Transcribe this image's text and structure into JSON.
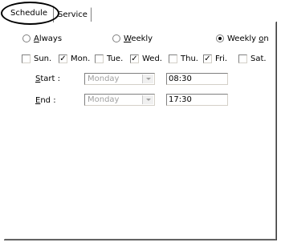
{
  "tabs": [
    {
      "label": "Schedule",
      "active": true
    },
    {
      "label": "Service",
      "active": false
    }
  ],
  "frequency": {
    "options": [
      {
        "label": "Always",
        "accel": "A",
        "rest": "lways",
        "selected": false
      },
      {
        "label": "Weekly",
        "accel": "W",
        "rest": "eekly",
        "selected": false
      },
      {
        "label": "Weekly on",
        "prefix": "Weekly ",
        "accel": "o",
        "rest": "n",
        "selected": true
      }
    ]
  },
  "days": [
    {
      "label": "Sun.",
      "checked": false,
      "mark": ""
    },
    {
      "label": "Mon.",
      "checked": true,
      "mark": "✓"
    },
    {
      "label": "Tue.",
      "checked": false,
      "mark": ""
    },
    {
      "label": "Wed.",
      "checked": true,
      "mark": "✓"
    },
    {
      "label": "Thu.",
      "checked": false,
      "mark": ""
    },
    {
      "label": "Fri.",
      "checked": true,
      "mark": "✓"
    },
    {
      "label": "Sat.",
      "checked": false,
      "mark": ""
    }
  ],
  "start": {
    "label": "Start :",
    "accel": "S",
    "rest": "tart :",
    "day": "Monday",
    "time": "08:30"
  },
  "end": {
    "label": "End :",
    "accel": "E",
    "rest": "nd :",
    "day": "Monday",
    "time": "17:30"
  },
  "colors": {
    "dialog_bg": "#ffffff",
    "disabled_text": "#a0a0a0",
    "highlight_oval": "#000000"
  }
}
